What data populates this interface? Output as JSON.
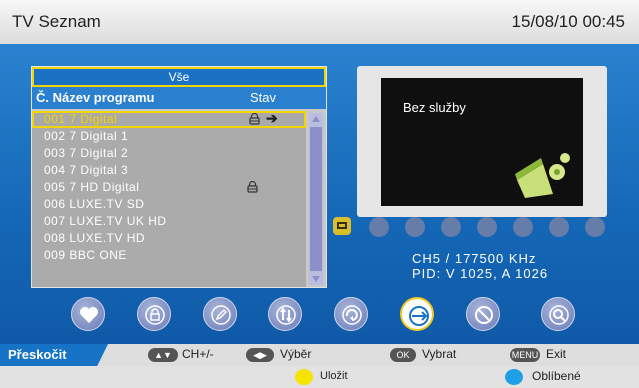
{
  "header": {
    "title": "TV Seznam",
    "datetime": "15/08/10  00:45"
  },
  "list": {
    "category": "Vše",
    "col_program": "Č. Název programu",
    "col_status": "Stav",
    "rows": [
      {
        "text": "001  7  Digital",
        "locked": true,
        "skip": true,
        "selected": true
      },
      {
        "text": "002  7  Digital  1",
        "locked": false,
        "skip": false,
        "selected": false
      },
      {
        "text": "003  7  Digital  2",
        "locked": false,
        "skip": false,
        "selected": false
      },
      {
        "text": "004  7  Digital  3",
        "locked": false,
        "skip": false,
        "selected": false
      },
      {
        "text": "005  7  HD  Digital",
        "locked": true,
        "skip": false,
        "selected": false
      },
      {
        "text": "006  LUXE.TV SD",
        "locked": false,
        "skip": false,
        "selected": false
      },
      {
        "text": "007  LUXE.TV UK  HD",
        "locked": false,
        "skip": false,
        "selected": false
      },
      {
        "text": "008  LUXE.TV HD",
        "locked": false,
        "skip": false,
        "selected": false
      },
      {
        "text": "009  BBC  ONE",
        "locked": false,
        "skip": false,
        "selected": false
      }
    ]
  },
  "preview": {
    "message": "Bez služby"
  },
  "info": {
    "line1": "CH5 / 177500  KHz",
    "line2": "PID: V 1025, A 1026"
  },
  "genre_icons": [
    "tv-icon",
    "film-reel-icon",
    "news-icon",
    "headphones-icon",
    "bowl-icon",
    "airplane-icon",
    "person-icon",
    "child-icon"
  ],
  "function_icons": [
    "favorite-heart-icon",
    "lock-icon",
    "edit-pencil-icon",
    "sort-arrows-icon",
    "move-icon",
    "skip-icon",
    "delete-icon",
    "find-icon"
  ],
  "footer": {
    "skip_label": "Přeskočit",
    "ch_key": "▲▼",
    "ch_label": "CH+/-",
    "select_key": "◀▶",
    "select_label": "Výběr",
    "ok_key": "OK",
    "ok_label": "Vybrat",
    "menu_key": "MENU",
    "menu_label": "Exit",
    "save_label": "Uložit",
    "fav_label": "Oblíbené"
  },
  "colors": {
    "accent": "#f2d400",
    "panel_blue": "#1467b6",
    "save_dot": "#f5e400",
    "fav_dot": "#1fa0e6"
  }
}
